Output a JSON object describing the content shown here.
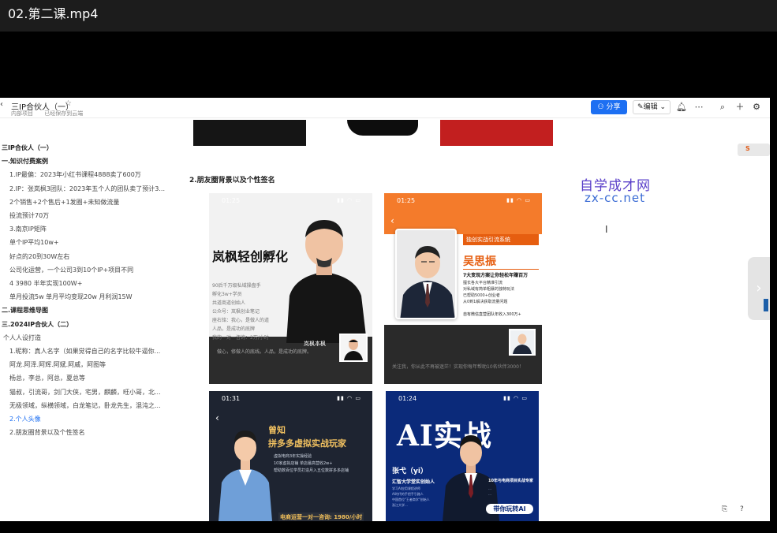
{
  "window": {
    "title": "02.第二课.mp4"
  },
  "doc": {
    "title": "三IP合伙人（一）",
    "meta_project": "内部项目",
    "meta_saved": "已经保存到云端",
    "share_label": "分享",
    "edit_label": "编辑"
  },
  "outline": {
    "items": [
      {
        "text": "三IP合伙人（一）",
        "level": "h"
      },
      {
        "text": "一.知识付费案例",
        "level": "h"
      },
      {
        "text": "1.IP最偏：2023年小红书课程4888卖了600万",
        "level": "n"
      },
      {
        "text": "2.IP：张岚枫3团队：2023年五个人的团队卖了预计3...",
        "level": "n"
      },
      {
        "text": "2个销售+2个售后+1发圈+未知做流量",
        "level": "n"
      },
      {
        "text": "投流预计70万",
        "level": "n"
      },
      {
        "text": "3.南京IP矩阵",
        "level": "n"
      },
      {
        "text": "单个IP平均10w+",
        "level": "n"
      },
      {
        "text": "好点的20到30W左右",
        "level": "n"
      },
      {
        "text": "公司化运营，一个公司3到10个IP+项目不同",
        "level": "n"
      },
      {
        "text": "4 3980 半年实现100W+",
        "level": "n"
      },
      {
        "text": "单月投流5w 单月平均变现20w 月利润15W",
        "level": "n"
      },
      {
        "text": "二.课程思维导图",
        "level": "h"
      },
      {
        "text": "三.2024IP合伙人（二）",
        "level": "h"
      },
      {
        "text": "个人人设打造",
        "level": "n"
      },
      {
        "text": "1.昵称：真人名字（如果觉得自己的名字比较牛逼你...",
        "level": "n"
      },
      {
        "text": "阿龙.阿泽.阿辉.阿斌.阿威，阿图等",
        "level": "n"
      },
      {
        "text": "杨总，李总，阿总，夏总等",
        "level": "n"
      },
      {
        "text": "猫叔，引流哥，剑门大侠，宅男，麒麟，旺小哥，北...",
        "level": "n"
      },
      {
        "text": "无极领域，纵横领域，白龙笔记，卧龙先生，混沌之...",
        "level": "n"
      },
      {
        "text": "2.个人头像",
        "level": "active"
      },
      {
        "text": "2.朋友圈背景以及个性签名",
        "level": "n"
      }
    ]
  },
  "content": {
    "section_heading": "2.朋友圈背景以及个性签名",
    "watermark_cn": "自学成才网",
    "watermark_url": "zx-cc.net",
    "card1": {
      "time": "01:25",
      "headline": "岚枫轻创孵化",
      "lines": [
        "90后千万级私域操盘手",
        "孵化3w+学员",
        "共道商道创始人",
        "公众号：岚枫创业笔记",
        "座右铭：我心，是做人的道",
        "人品，是成功的底牌",
        "我的一对一咨询：2万/小时"
      ],
      "nametag": "岚枫本枫",
      "bottom_text": "做心，修做人的底线。人品，是成功的底牌。"
    },
    "card2": {
      "time": "01:25",
      "system": "独创实战引流系统",
      "name": "吴思振",
      "tag": "7大变现方案让你轻松年赚百万",
      "desc": [
        "擅长各大平台精准引流",
        "对私域有简单粗暴的独特玩法",
        "已帮助5000+创业者",
        "从0到1解决获取流量问题"
      ],
      "bottom": "自有微信直营团队年收入300万+",
      "dark_text": "关注我，你从此不再被迷茫！实现你每年帮助10名伙伴3000！"
    },
    "card3": {
      "time": "01:31",
      "t1": "曾知",
      "t2": "拼多多虚拟实战玩家",
      "lines": [
        "虚拟电商3年实操经验",
        "10家虚拟店铺 单店最高营收2w+",
        "帮助数百位学员打造月入五位数拼多多店铺"
      ],
      "price": "电商运营一对一咨询: 1980/小时"
    },
    "card4": {
      "time": "01:24",
      "ai": "AI实战",
      "n1": "张弋（yi）",
      "n2": "汇智大学堂实创始人",
      "lines": [
        "学习AI应用课程讲师",
        "AI时代的手把手引路人",
        "中国首位\"王者商学\"创始人",
        "浙江大学…"
      ],
      "r1": "10年与电商项目实战专家",
      "r2": [
        "…",
        "…"
      ],
      "cta": "带你玩转AI"
    }
  },
  "colors": {
    "accent": "#1d6ff2",
    "card2_orange": "#f47b2b",
    "card4_blue": "#0b2a7a"
  }
}
